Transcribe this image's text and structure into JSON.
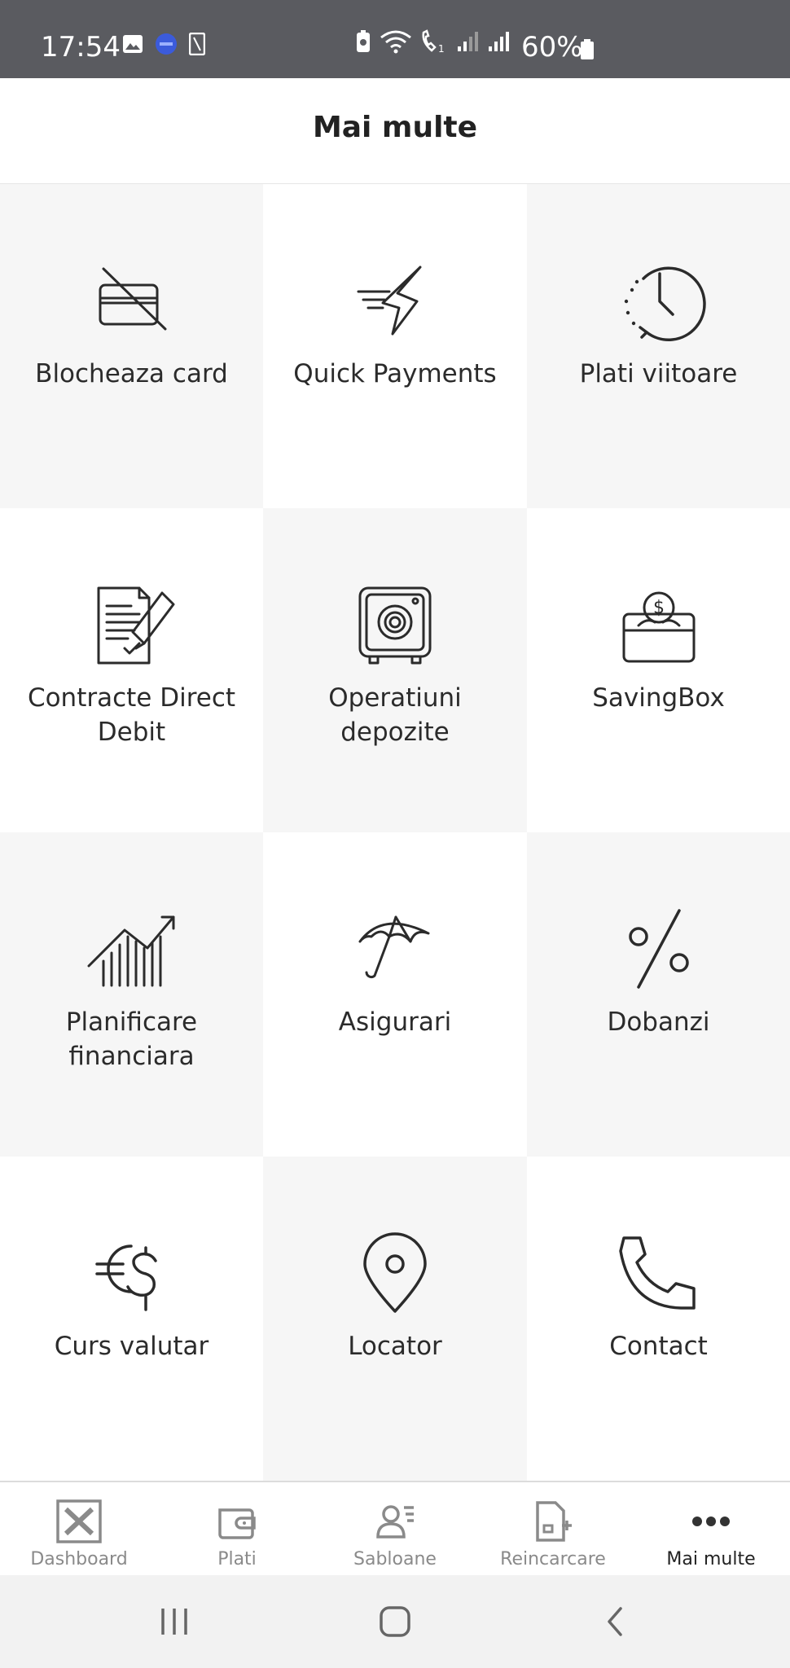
{
  "status_bar": {
    "time": "17:54",
    "battery_text": "60%",
    "left_icons": [
      "image-icon",
      "app-badge-icon",
      "tablet-icon"
    ],
    "right_icons": [
      "battery-saver-icon",
      "wifi-icon",
      "volte-call-icon",
      "signal-1-icon",
      "signal-2-icon",
      "battery-icon"
    ]
  },
  "header": {
    "title": "Mai multe"
  },
  "tiles": [
    {
      "label": "Blocheaza card",
      "icon": "blocked-card-icon"
    },
    {
      "label": "Quick Payments",
      "icon": "lightning-icon"
    },
    {
      "label": "Plati viitoare",
      "icon": "clock-icon"
    },
    {
      "label": "Contracte Direct Debit",
      "icon": "contract-icon"
    },
    {
      "label": "Operatiuni depozite",
      "icon": "safe-icon"
    },
    {
      "label": "SavingBox",
      "icon": "saving-box-icon"
    },
    {
      "label": "Planificare financiara",
      "icon": "growth-chart-icon"
    },
    {
      "label": "Asigurari",
      "icon": "umbrella-icon"
    },
    {
      "label": "Dobanzi",
      "icon": "percent-icon"
    },
    {
      "label": "Curs valutar",
      "icon": "currency-exchange-icon"
    },
    {
      "label": "Locator",
      "icon": "location-pin-icon"
    },
    {
      "label": "Contact",
      "icon": "phone-icon"
    }
  ],
  "bottom_nav": [
    {
      "label": "Dashboard",
      "icon": "dashboard-icon",
      "active": false
    },
    {
      "label": "Plati",
      "icon": "wallet-icon",
      "active": false
    },
    {
      "label": "Sabloane",
      "icon": "templates-icon",
      "active": false
    },
    {
      "label": "Reincarcare",
      "icon": "recharge-icon",
      "active": false
    },
    {
      "label": "Mai multe",
      "icon": "more-dots-icon",
      "active": true
    }
  ],
  "system_nav": {
    "buttons": [
      "recent-apps-icon",
      "home-icon",
      "back-icon"
    ]
  },
  "colors": {
    "status_bar_bg": "#5a5b60",
    "tile_gray": "#f6f6f6",
    "active_nav": "#222222",
    "inactive_nav": "#8a8a8a"
  }
}
